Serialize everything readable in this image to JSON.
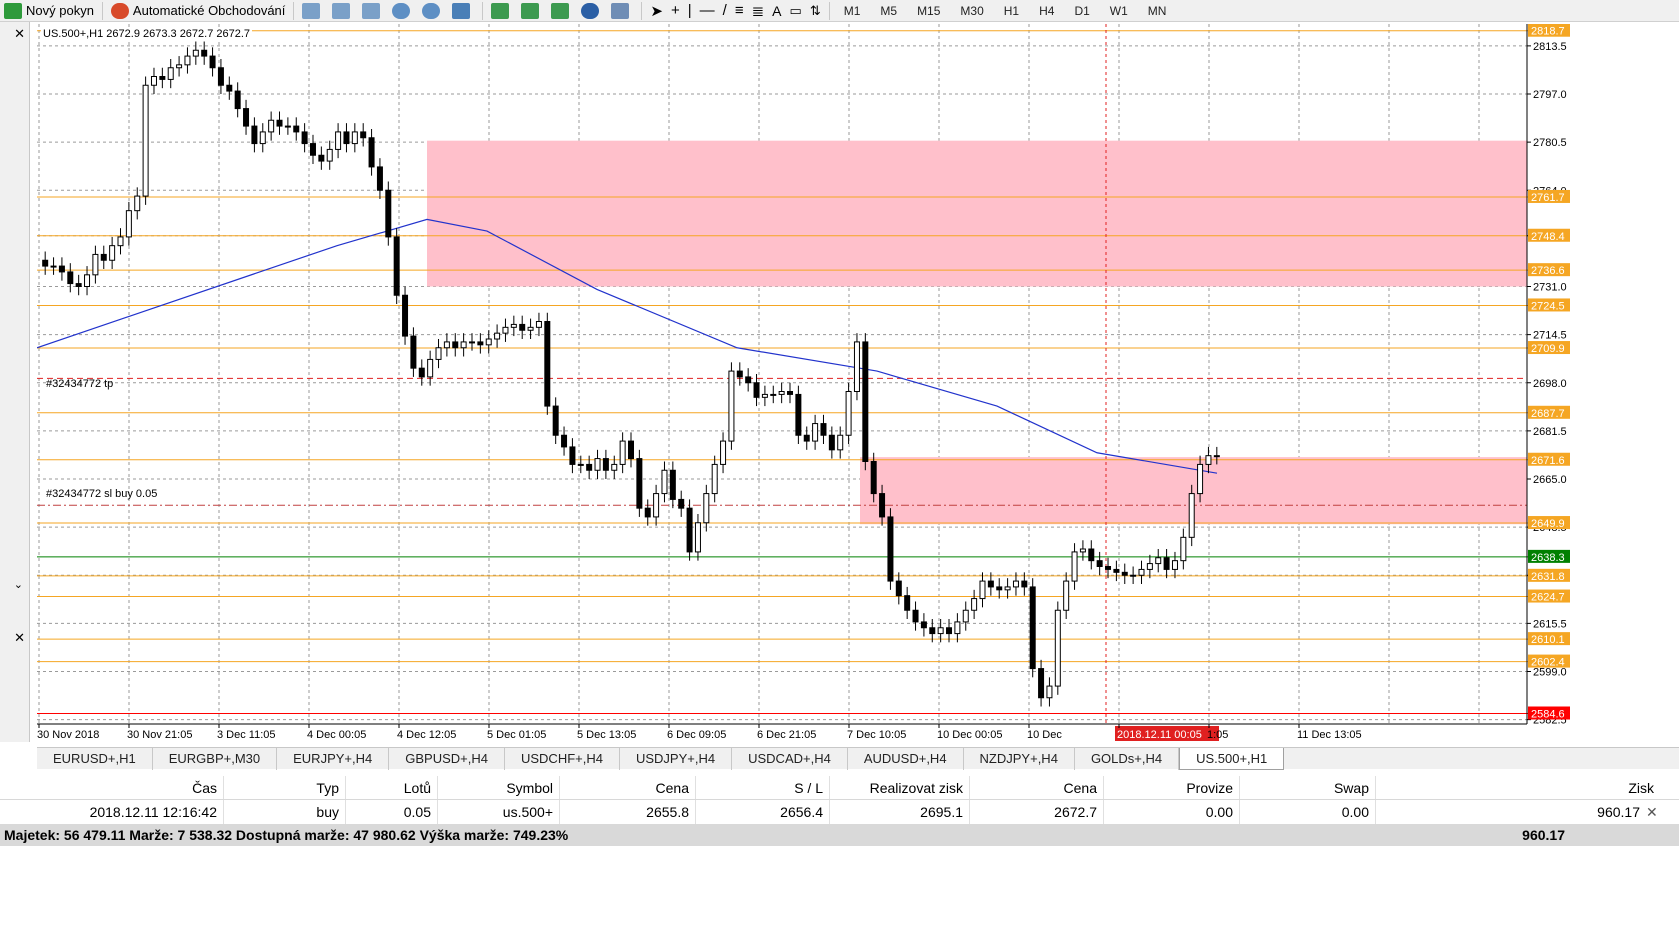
{
  "toolbar": {
    "new_order": "Nový pokyn",
    "auto_trading": "Automatické Obchodování",
    "timeframes": [
      "M1",
      "M5",
      "M15",
      "M30",
      "H1",
      "H4",
      "D1",
      "W1",
      "MN"
    ],
    "colors": {
      "bg": "#f0f0f0"
    }
  },
  "chart": {
    "header": "US.500+,H1  2672.9 2673.3 2672.7 2672.7",
    "tp_label": "#32434772 tp",
    "order_label": "#32434772 sl buy 0.05",
    "price_ticks": [
      "2813.5",
      "2797.0",
      "2780.5",
      "2764.0",
      "2748.4",
      "2731.0",
      "2714.5",
      "2698.0",
      "2681.5",
      "2665.0",
      "2648.5",
      "2632.0",
      "2615.5",
      "2599.0",
      "2582.5"
    ],
    "level_labels": [
      {
        "value": "2818.7",
        "color": "#f5a623"
      },
      {
        "value": "2761.7",
        "color": "#f5a623"
      },
      {
        "value": "2748.4",
        "color": "#f5a623"
      },
      {
        "value": "2736.6",
        "color": "#f5a623"
      },
      {
        "value": "2724.5",
        "color": "#f5a623"
      },
      {
        "value": "2709.9",
        "color": "#f5a623"
      },
      {
        "value": "2687.7",
        "color": "#f5a623"
      },
      {
        "value": "2671.6",
        "color": "#f5a623"
      },
      {
        "value": "2649.9",
        "color": "#f5a623"
      },
      {
        "value": "2638.3",
        "color": "#008000"
      },
      {
        "value": "2631.8",
        "color": "#f5a623"
      },
      {
        "value": "2624.7",
        "color": "#f5a623"
      },
      {
        "value": "2610.1",
        "color": "#f5a623"
      },
      {
        "value": "2602.4",
        "color": "#f5a623"
      },
      {
        "value": "2584.6",
        "color": "#ff0000"
      }
    ],
    "time_ticks": [
      "30 Nov 2018",
      "30 Nov 21:05",
      "3 Dec 11:05",
      "4 Dec 00:05",
      "4 Dec 12:05",
      "5 Dec 01:05",
      "5 Dec 13:05",
      "6 Dec 09:05",
      "6 Dec 21:05",
      "7 Dec 10:05",
      "10 Dec 00:05",
      "10 Dec",
      "2018.12.11 00:05",
      "1:05",
      "11 Dec 13:05"
    ]
  },
  "chart_data": {
    "type": "candlestick",
    "ylim": [
      2581,
      2821
    ],
    "x_labels": [
      "30 Nov 2018",
      "30 Nov 21:05",
      "3 Dec 11:05",
      "4 Dec 00:05",
      "4 Dec 12:05",
      "5 Dec 01:05",
      "5 Dec 13:05",
      "6 Dec 09:05",
      "6 Dec 21:05",
      "7 Dec 10:05",
      "10 Dec 00:05",
      "10 Dec",
      "1:05",
      "11 Dec 13:05"
    ],
    "close": [
      2738,
      2738,
      2736,
      2732,
      2731,
      2735,
      2742,
      2740,
      2745,
      2748,
      2757,
      2762,
      2800,
      2803,
      2802,
      2806,
      2807,
      2810,
      2812,
      2810,
      2806,
      2800,
      2798,
      2792,
      2786,
      2780,
      2784,
      2788,
      2786,
      2786,
      2784,
      2780,
      2776,
      2774,
      2778,
      2784,
      2780,
      2784,
      2782,
      2772,
      2764,
      2748,
      2728,
      2714,
      2703,
      2700,
      2706,
      2710,
      2712,
      2710,
      2712,
      2712,
      2711,
      2713,
      2715,
      2717,
      2718,
      2716,
      2717,
      2719,
      2690,
      2680,
      2676,
      2670,
      2670,
      2668,
      2672,
      2668,
      2670,
      2678,
      2672,
      2655,
      2652,
      2660,
      2668,
      2658,
      2655,
      2640,
      2650,
      2660,
      2670,
      2678,
      2702,
      2700,
      2698,
      2693,
      2694,
      2694,
      2695,
      2694,
      2680,
      2678,
      2684,
      2680,
      2675,
      2680,
      2695,
      2712,
      2671,
      2660,
      2652,
      2630,
      2625,
      2620,
      2616,
      2614,
      2612,
      2614,
      2612,
      2616,
      2620,
      2624,
      2630,
      2628,
      2627,
      2628,
      2630,
      2628,
      2600,
      2590,
      2594,
      2620,
      2630,
      2640,
      2641,
      2637,
      2635,
      2634,
      2633,
      2632,
      2632,
      2634,
      2636,
      2638,
      2634,
      2637,
      2645,
      2660,
      2670,
      2673,
      2673
    ],
    "series": [
      {
        "name": "ma",
        "values": [
          2710,
          2745,
          2754,
          2750,
          2730,
          2710,
          2702,
          2690,
          2674,
          2667
        ]
      }
    ],
    "x": [
      "30 Nov 2018",
      "4 Dec 00:05",
      "4 Dec 12:05",
      "5 Dec 01:05",
      "5 Dec 13:05",
      "6 Dec 21:05",
      "7 Dec 10:05",
      "10 Dec 00:05",
      "10 Dec",
      "11 Dec 13:05"
    ],
    "grid": true
  },
  "tabs": [
    "EURUSD+,H1",
    "EURGBP+,M30",
    "EURJPY+,H4",
    "GBPUSD+,H4",
    "USDCHF+,H4",
    "USDJPY+,H4",
    "USDCAD+,H4",
    "AUDUSD+,H4",
    "NZDJPY+,H4",
    "GOLDs+,H4",
    "US.500+,H1"
  ],
  "active_tab": "US.500+,H1",
  "table": {
    "headers": [
      "Čas",
      "Typ",
      "Lotů",
      "Symbol",
      "Cena",
      "S / L",
      "Realizovat zisk",
      "Cena",
      "Provize",
      "Swap",
      "Zisk"
    ],
    "row": [
      "2018.12.11 12:16:42",
      "buy",
      "0.05",
      "us.500+",
      "2655.8",
      "2656.4",
      "2695.1",
      "2672.7",
      "0.00",
      "0.00",
      "960.17"
    ]
  },
  "summary": {
    "left": "Majetek: 56 479.11  Marže: 7 538.32  Dostupná marže: 47 980.62  Výška marže: 749.23%",
    "right": "960.17"
  }
}
